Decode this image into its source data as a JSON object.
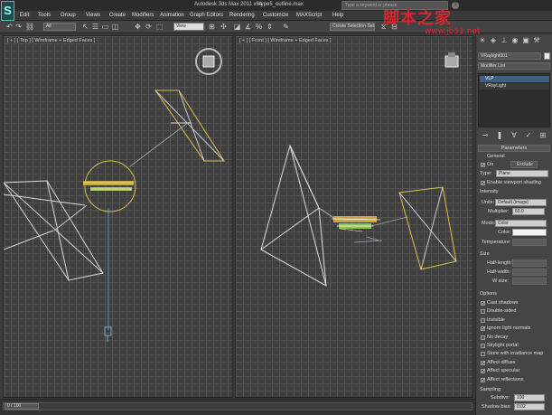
{
  "title": "Autodesk 3ds Max 2011 x64",
  "file_name": "type5_outline.max",
  "search_placeholder": "Type a keyword or phrase",
  "watermark": {
    "text": "脚本之家",
    "url": "www.jb51.net"
  },
  "menu": [
    "Edit",
    "Tools",
    "Group",
    "Views",
    "Create",
    "Modifiers",
    "Animation",
    "Graph Editors",
    "Rendering",
    "Customize",
    "MAXScript",
    "Help"
  ],
  "toolbar": {
    "selection_filter": "All",
    "ref_coord": "View",
    "named_selection": "Create Selection Set"
  },
  "viewports": {
    "left_label": "[ + ] [ Top ] [ Wireframe + Edged Faces ]",
    "right_label": "[ + ] [ Front ] [ Wireframe + Edged Faces ]"
  },
  "command_panel": {
    "object_name": "VRaylight001",
    "modifier_list": "Modifier List",
    "stack_items": [
      "VLP",
      "VRayLight"
    ],
    "rollout_title": "Parameters",
    "general_label": "General",
    "on_label": "On",
    "exclude_label": "Exclude",
    "type_label": "Type:",
    "type_value": "Plane",
    "enable_viewport": "Enable viewport shading",
    "intensity_label": "Intensity",
    "units_label": "Units:",
    "units_value": "Default (image)",
    "multiplier_label": "Multiplier:",
    "multiplier_value": "60.0",
    "mode_label": "Mode:",
    "mode_value": "Color",
    "color_label": "Color:",
    "temperature_label": "Temperature:",
    "size_label": "Size",
    "half_length": "Half-length:",
    "half_width": "Half-width:",
    "w_size": "W size:",
    "options_label": "Options",
    "options": [
      {
        "label": "Cast shadows",
        "checked": true
      },
      {
        "label": "Double-sided",
        "checked": false
      },
      {
        "label": "Invisible",
        "checked": false
      },
      {
        "label": "Ignore light normals",
        "checked": true
      },
      {
        "label": "No decay",
        "checked": false
      },
      {
        "label": "Skylight portal",
        "checked": false
      },
      {
        "label": "Store with irradiance map",
        "checked": false
      },
      {
        "label": "Affect diffuse",
        "checked": true
      },
      {
        "label": "Affect specular",
        "checked": true
      },
      {
        "label": "Affect reflections",
        "checked": true
      }
    ],
    "simple_label": "Simple",
    "sampling_label": "Sampling",
    "subdivs_label": "Subdivs:",
    "subdivs_value": "100",
    "shadow_bias_label": "Shadow bias:",
    "shadow_bias_value": "0.02"
  },
  "timeslider": {
    "frame": "0 / 100"
  }
}
